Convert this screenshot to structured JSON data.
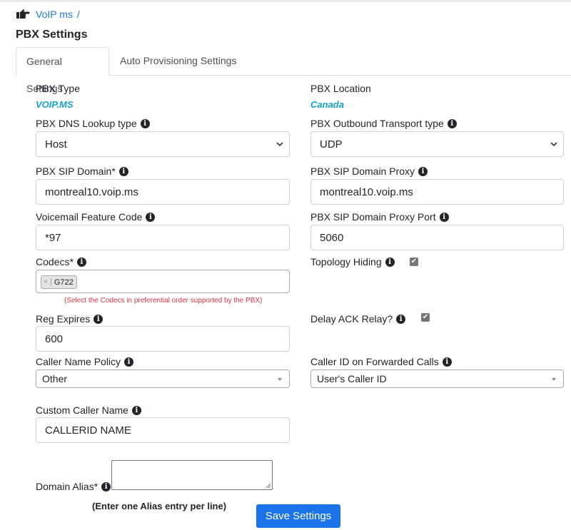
{
  "breadcrumb": {
    "item": "VoIP ms",
    "separator": "/"
  },
  "page_title": "PBX Settings",
  "tabs": [
    {
      "label": "General Settings",
      "active": true
    },
    {
      "label": "Auto Provisioning Settings",
      "active": false
    }
  ],
  "form": {
    "pbx_type": {
      "label": "PBX Type",
      "value": "VOIP.MS"
    },
    "pbx_location": {
      "label": "PBX Location",
      "value": "Canada"
    },
    "dns_lookup": {
      "label": "PBX DNS Lookup type",
      "value": "Host"
    },
    "outbound_transport": {
      "label": "PBX Outbound Transport type",
      "value": "UDP"
    },
    "sip_domain": {
      "label": "PBX SIP Domain*",
      "value": "montreal10.voip.ms"
    },
    "sip_domain_proxy": {
      "label": "PBX SIP Domain Proxy",
      "value": "montreal10.voip.ms"
    },
    "voicemail_code": {
      "label": "Voicemail Feature Code",
      "value": "*97"
    },
    "proxy_port": {
      "label": "PBX SIP Domain Proxy Port",
      "value": "5060"
    },
    "codecs": {
      "label": "Codecs*",
      "chip": "G722",
      "chip_remove": "×",
      "hint": "(Select the Codecs in preferential order supported by the PBX)"
    },
    "topology_hiding": {
      "label": "Topology Hiding",
      "checked": true
    },
    "reg_expires": {
      "label": "Reg Expires",
      "value": "600"
    },
    "delay_ack": {
      "label": "Delay ACK Relay?",
      "checked": true
    },
    "caller_name_policy": {
      "label": "Caller Name Policy",
      "value": "Other"
    },
    "caller_id_forwarded": {
      "label": "Caller ID on Forwarded Calls",
      "value": "User's Caller ID"
    },
    "custom_caller_name": {
      "label": "Custom Caller Name",
      "value": "CALLERID NAME"
    },
    "domain_alias": {
      "label": "Domain Alias*",
      "value": "",
      "hint": "(Enter one Alias entry per line)"
    }
  },
  "info_glyph": "i",
  "check_glyph": "✔",
  "save_button": "Save Settings",
  "colors": {
    "link": "#1d7bd6",
    "value_accent": "#17a2c8",
    "hint_red": "#dc3545",
    "button": "#1a73e8"
  }
}
